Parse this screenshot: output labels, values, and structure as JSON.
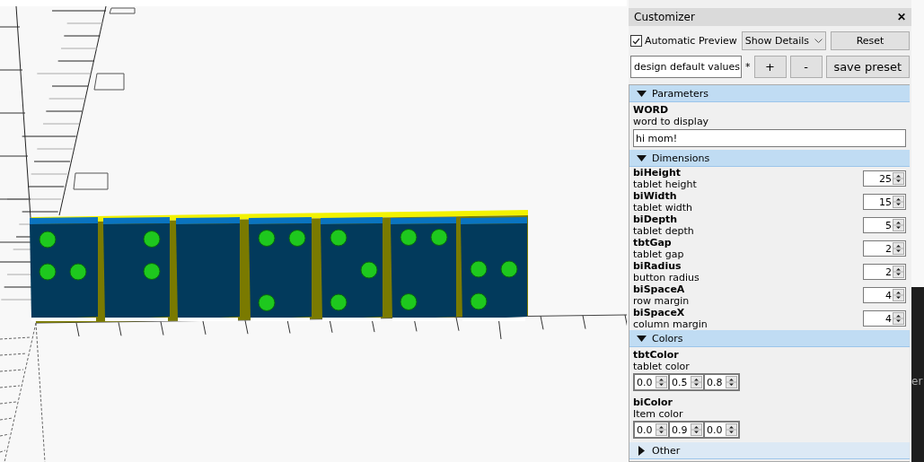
{
  "customizer": {
    "title": "Customizer",
    "close": "✕",
    "automatic_preview": {
      "label": "Automatic Preview",
      "checked": true
    },
    "details_select": "Show Details",
    "reset": "Reset",
    "preset_select": "design default values",
    "modified_mark": "*",
    "add_button": "+",
    "remove_button": "-",
    "save_button": "save preset",
    "sections": [
      {
        "title": "Parameters",
        "expanded": true,
        "params": [
          {
            "kind": "text",
            "name": "WORD",
            "description": "word to display",
            "value": "hi mom!"
          }
        ]
      },
      {
        "title": "Dimensions",
        "expanded": true,
        "params": [
          {
            "kind": "number",
            "name": "biHeight",
            "description": "tablet height",
            "value": "25"
          },
          {
            "kind": "number",
            "name": "biWidth",
            "description": "tablet width",
            "value": "15"
          },
          {
            "kind": "number",
            "name": "biDepth",
            "description": "tablet depth",
            "value": "5"
          },
          {
            "kind": "number",
            "name": "tbtGap",
            "description": "tablet gap",
            "value": "2"
          },
          {
            "kind": "number",
            "name": "biRadius",
            "description": "button radius",
            "value": "2"
          },
          {
            "kind": "number",
            "name": "biSpaceA",
            "description": "row margin",
            "value": "4"
          },
          {
            "kind": "number",
            "name": "biSpaceX",
            "description": "column margin",
            "value": "4"
          }
        ]
      },
      {
        "title": "Colors",
        "expanded": true,
        "params": [
          {
            "kind": "vector",
            "name": "tbtColor",
            "description": "tablet color",
            "values": [
              "0.0",
              "0.5",
              "0.8"
            ]
          },
          {
            "kind": "vector",
            "name": "biColor",
            "description": "Item color",
            "values": [
              "0.0",
              "0.9",
              "0.0"
            ]
          }
        ]
      },
      {
        "title": "Other",
        "expanded": false
      }
    ]
  },
  "background_window": {
    "text": "er"
  }
}
